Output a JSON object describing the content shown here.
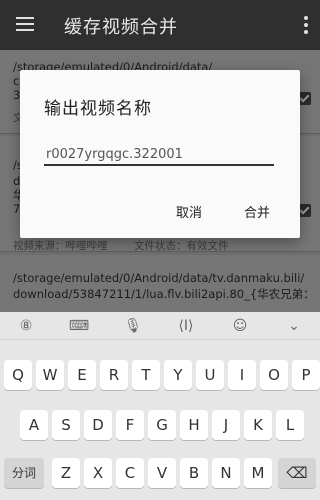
{
  "appbar": {
    "title": "缓存视频合并",
    "menu_icon": "hamburger-menu-icon",
    "more_icon": "overflow-menu-icon"
  },
  "list": {
    "item1": {
      "path_line1": "/storage/emulated/0/Android/data/",
      "path_line2": "co",
      "path_line3": "32",
      "meta": "文"
    },
    "item2": {
      "path_line1": "/s",
      "path_line2": "do",
      "path_line3": "华",
      "path_line4": "72",
      "source": "视频来源：哔哩哔哩",
      "status": "文件状态：有效文件"
    },
    "item3": {
      "path_line1": "/storage/emulated/0/Android/data/tv.danmaku.bili/",
      "path_line2": "download/53847211/1/lua.flv.bili2api.80_{华农兄弟："
    }
  },
  "dialog": {
    "title": "输出视频名称",
    "input_value": "r0027yrgqgc.322001",
    "cancel_label": "取消",
    "merge_label": "合并"
  },
  "keyboard": {
    "toolbar": {
      "settings": "⑧",
      "keyboard": "⌨",
      "mic": "🎙",
      "cursor": "⟨I⟩",
      "emoji": "☺",
      "hide": "⌄"
    },
    "row1": [
      "Q",
      "W",
      "E",
      "R",
      "T",
      "Y",
      "U",
      "I",
      "O",
      "P"
    ],
    "row2": [
      "A",
      "S",
      "D",
      "F",
      "G",
      "H",
      "J",
      "K",
      "L"
    ],
    "row3": [
      "Z",
      "X",
      "C",
      "V",
      "B",
      "N",
      "M"
    ],
    "left_key": "分词",
    "backspace": "⌫"
  }
}
